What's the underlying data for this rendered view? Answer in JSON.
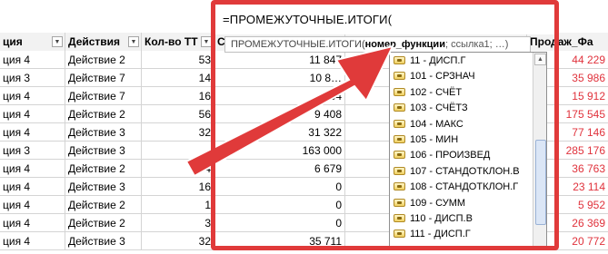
{
  "spreadsheet": {
    "headers": [
      "ция",
      "Действия",
      "Кол-во ТТ",
      "С",
      "",
      "Продаж_Фа"
    ],
    "rows": [
      [
        "ция 4",
        "Действие 2",
        "53",
        "11 847",
        "",
        "44 229"
      ],
      [
        "ция 3",
        "Действие 7",
        "14",
        "10 8…",
        "",
        "35 986"
      ],
      [
        "ция 4",
        "Действие 7",
        "16",
        "…664",
        "",
        "15 912"
      ],
      [
        "ция 4",
        "Действие 2",
        "56",
        "9 408",
        "",
        "175 545"
      ],
      [
        "ция 4",
        "Действие 3",
        "32",
        "31 322",
        "",
        "77 146"
      ],
      [
        "ция 3",
        "Действие 3",
        "",
        "163 000",
        "",
        "285 176"
      ],
      [
        "ция 4",
        "Действие 2",
        "4",
        "6 679",
        "",
        "36 763"
      ],
      [
        "ция 4",
        "Действие 3",
        "16",
        "0",
        "",
        "23 114"
      ],
      [
        "ция 4",
        "Действие 2",
        "1",
        "0",
        "",
        "5 952"
      ],
      [
        "ция 4",
        "Действие 2",
        "3",
        "0",
        "",
        "26 369"
      ],
      [
        "ция 4",
        "Действие 3",
        "32",
        "35 711",
        "",
        "20 772"
      ]
    ]
  },
  "formula_bar": {
    "text": "=ПРОМЕЖУТОЧНЫЕ.ИТОГИ("
  },
  "tooltip": {
    "func": "ПРОМЕЖУТОЧНЫЕ.ИТОГИ(",
    "arg_bold": "номер_функции",
    "rest": "; ссылка1; …)"
  },
  "function_list": [
    "11 - ДИСП.Г",
    "101 - СРЗНАЧ",
    "102 - СЧЁТ",
    "103 - СЧЁТЗ",
    "104 - МАКС",
    "105 - МИН",
    "106 - ПРОИЗВЕД",
    "107 - СТАНДОТКЛОН.В",
    "108 - СТАНДОТКЛОН.Г",
    "109 - СУММ",
    "110 - ДИСП.В",
    "111 - ДИСП.Г"
  ],
  "colors": {
    "highlight": "#e03a3a",
    "negative_values": "#e0323c",
    "list_icon": "#f0d060"
  },
  "icons": {
    "filter": "filter-dropdown-icon",
    "function": "function-icon",
    "scroll_up": "scroll-up-icon",
    "arrow": "red-arrow-annotation"
  }
}
